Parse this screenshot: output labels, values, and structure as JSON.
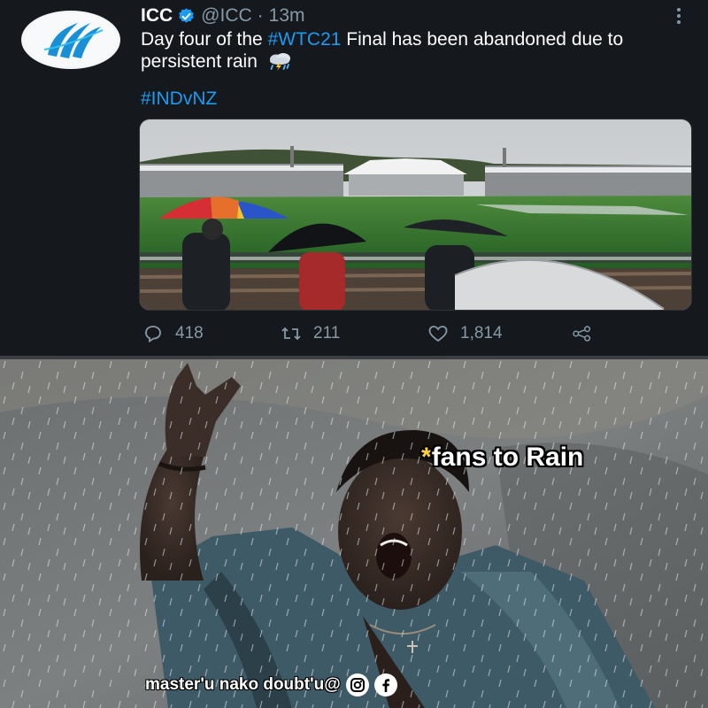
{
  "tweet": {
    "author": {
      "name": "ICC",
      "handle": "@ICC",
      "separator": "·",
      "time": "13m",
      "verified": true
    },
    "text_before": "Day four of the ",
    "hashtag_main": "#WTC21",
    "text_after": " Final has been abandoned due to persistent rain",
    "emoji_icon": "cloud-rain-lightning-icon",
    "hashtag_secondary": "#INDvNZ",
    "stats": {
      "replies": "418",
      "retweets": "211",
      "likes": "1,814"
    },
    "colors": {
      "background": "#15181c",
      "link": "#1d9bf0",
      "muted": "#8899a6",
      "verified": "#1d9bf0"
    }
  },
  "meme": {
    "caption_star": "*",
    "caption_text": "fans to Rain",
    "watermark": "master'u nako doubt'u@",
    "watermark_icons": [
      "instagram-icon",
      "facebook-icon"
    ]
  }
}
